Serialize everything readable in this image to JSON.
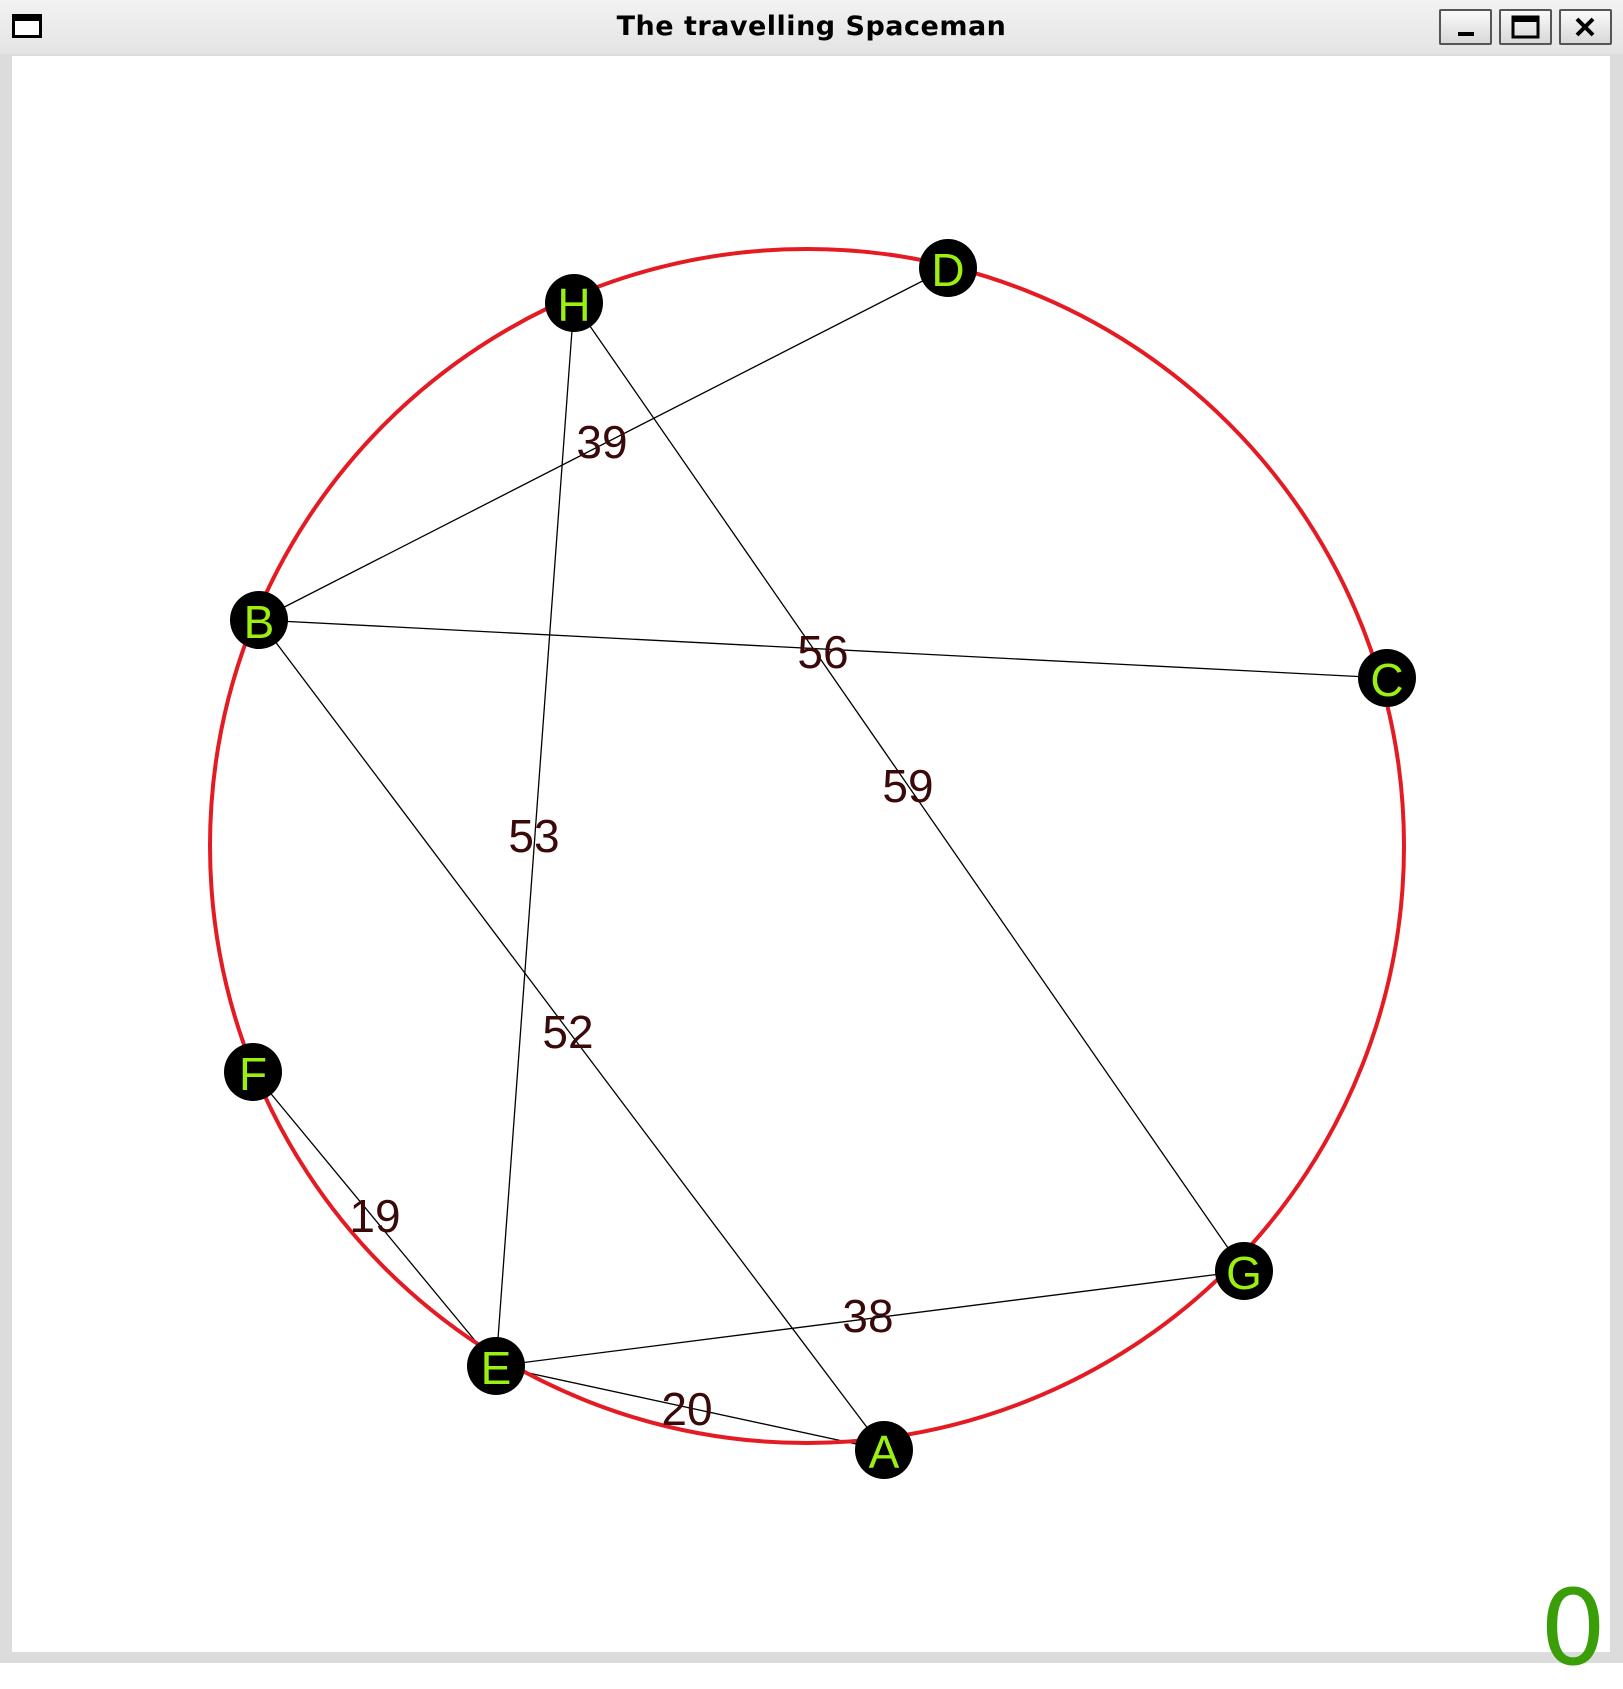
{
  "window": {
    "title": "The travelling Spaceman",
    "controls": {
      "minimize": "minimize",
      "maximize": "maximize",
      "close": "close"
    }
  },
  "graph": {
    "nodes": [
      {
        "label": "A"
      },
      {
        "label": "B"
      },
      {
        "label": "C"
      },
      {
        "label": "D"
      },
      {
        "label": "E"
      },
      {
        "label": "F"
      },
      {
        "label": "G"
      },
      {
        "label": "H"
      }
    ],
    "edges": [
      {
        "from": "B",
        "to": "D",
        "weight": "39"
      },
      {
        "from": "B",
        "to": "C",
        "weight": "56"
      },
      {
        "from": "H",
        "to": "G",
        "weight": "59"
      },
      {
        "from": "H",
        "to": "E",
        "weight": "53"
      },
      {
        "from": "B",
        "to": "A",
        "weight": "52"
      },
      {
        "from": "F",
        "to": "E",
        "weight": "19"
      },
      {
        "from": "E",
        "to": "G",
        "weight": "38"
      },
      {
        "from": "E",
        "to": "A",
        "weight": "20"
      }
    ]
  },
  "colors": {
    "circle": "#e41b23",
    "node_fill": "#000000",
    "node_label": "#9cf00f",
    "edge": "#000000",
    "weight_label": "#3a0a0a",
    "counter": "#3a9e09"
  },
  "counter": {
    "value": "0"
  }
}
